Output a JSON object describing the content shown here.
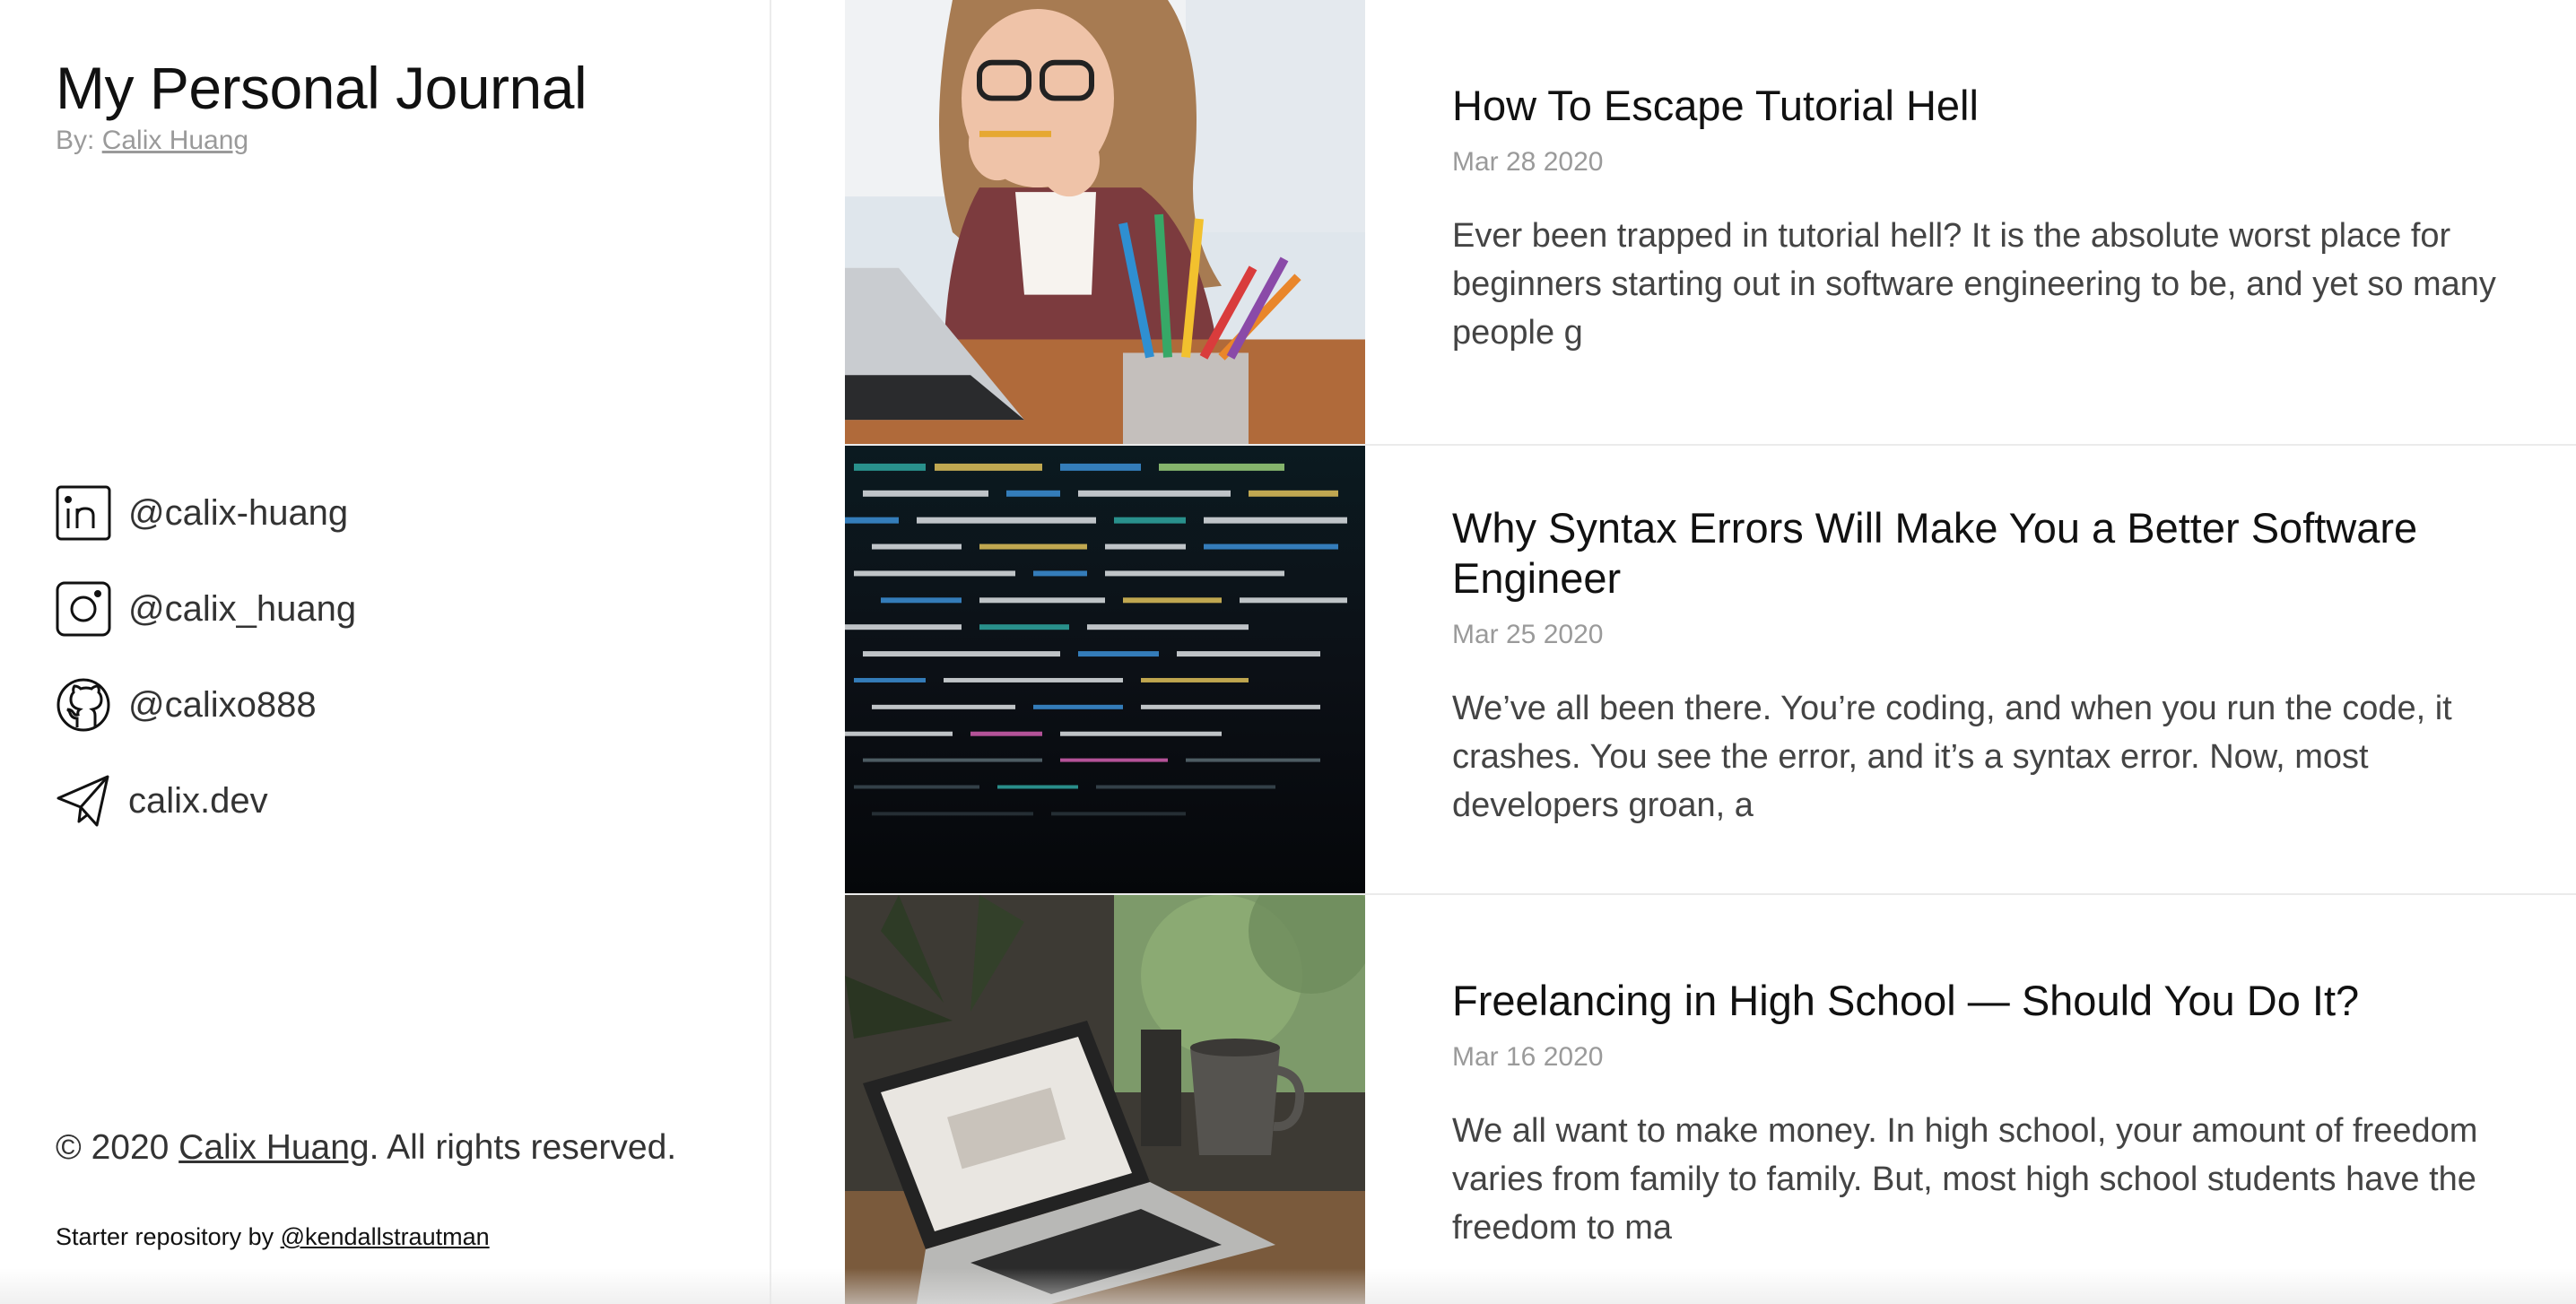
{
  "site": {
    "title": "My Personal Journal",
    "byline_prefix": "By: ",
    "author": "Calix Huang"
  },
  "socials": [
    {
      "icon": "linkedin-icon",
      "handle": "@calix-huang"
    },
    {
      "icon": "instagram-icon",
      "handle": "@calix_huang"
    },
    {
      "icon": "github-icon",
      "handle": "@calixo888"
    },
    {
      "icon": "paper-plane-icon",
      "handle": "calix.dev"
    }
  ],
  "footer": {
    "copyright_prefix": "© 2020 ",
    "copyright_author": "Calix Huang",
    "copyright_suffix": ". All rights reserved.",
    "starter_prefix": "Starter repository by ",
    "starter_link": "@kendallstrautman"
  },
  "posts": [
    {
      "title": "How To Escape Tutorial Hell",
      "date": "Mar 28 2020",
      "excerpt": "Ever been trapped in tutorial hell? It is the absolute worst place for beginners starting out in software engineering to be, and yet so many people g"
    },
    {
      "title": "Why Syntax Errors Will Make You a Better Software Engineer",
      "date": "Mar 25 2020",
      "excerpt": "We’ve all been there. You’re coding, and when you run the code, it crashes. You see the error, and it’s a syntax error. Now, most developers groan, a"
    },
    {
      "title": "Freelancing in High School — Should You Do It?",
      "date": "Mar 16 2020",
      "excerpt": "We all want to make money. In high school, your amount of freedom varies from family to family. But, most high school students have the freedom to ma"
    }
  ],
  "colors": {
    "text": "#111111",
    "muted": "#9a9a9a",
    "divider": "#ebebeb"
  }
}
